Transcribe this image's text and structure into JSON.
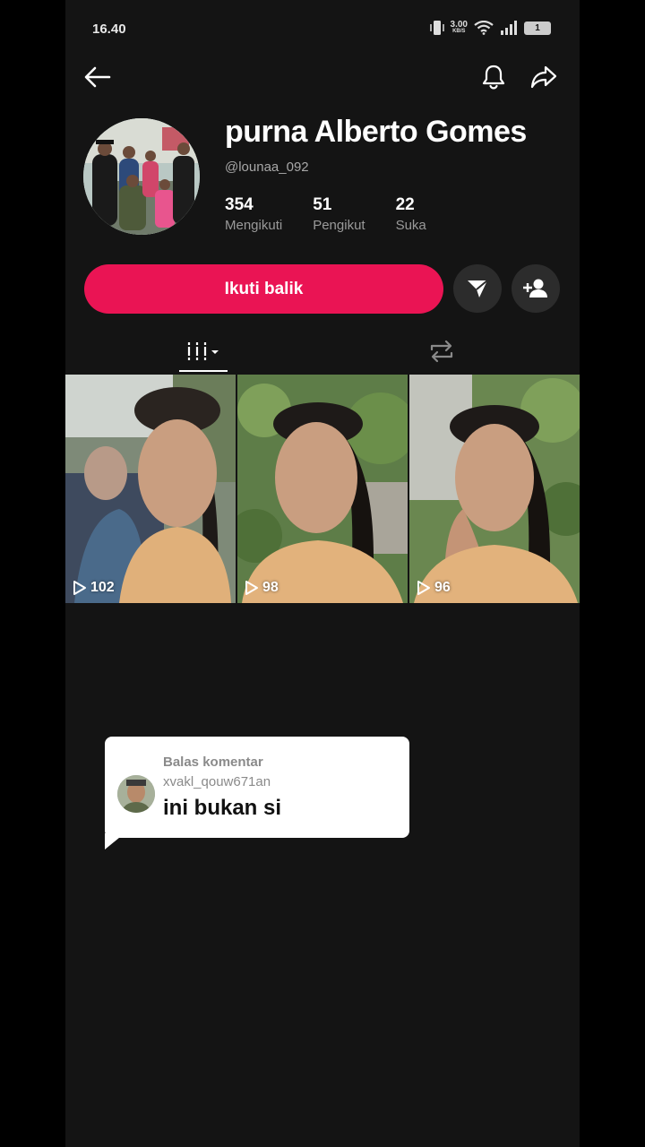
{
  "status_bar": {
    "time": "16.40",
    "net_speed": "3.00",
    "net_unit": "KB/S",
    "battery": "1",
    "icons": [
      "vibrate-icon",
      "wifi-icon",
      "signal-icon",
      "battery-icon"
    ]
  },
  "header": {
    "icons": [
      "back-arrow-icon",
      "bell-icon",
      "share-icon"
    ]
  },
  "profile": {
    "name": "purna Alberto Gomes",
    "handle": "@lounaa_092",
    "stats": [
      {
        "value": "354",
        "label": "Mengikuti"
      },
      {
        "value": "51",
        "label": "Pengikut"
      },
      {
        "value": "22",
        "label": "Suka"
      }
    ]
  },
  "actions": {
    "follow_label": "Ikuti balik",
    "accent_color": "#ea1454",
    "icons": [
      "send-message-icon",
      "add-friend-icon"
    ]
  },
  "tabs": [
    {
      "name": "videos",
      "icon": "grid-dropdown-icon",
      "active": true
    },
    {
      "name": "reposts",
      "icon": "repost-icon",
      "active": false
    }
  ],
  "videos": [
    {
      "views": "102"
    },
    {
      "views": "98"
    },
    {
      "views": "96"
    }
  ],
  "reply_bubble": {
    "title": "Balas komentar",
    "username": "xvakl_qouw671an",
    "comment": "ini bukan si"
  }
}
